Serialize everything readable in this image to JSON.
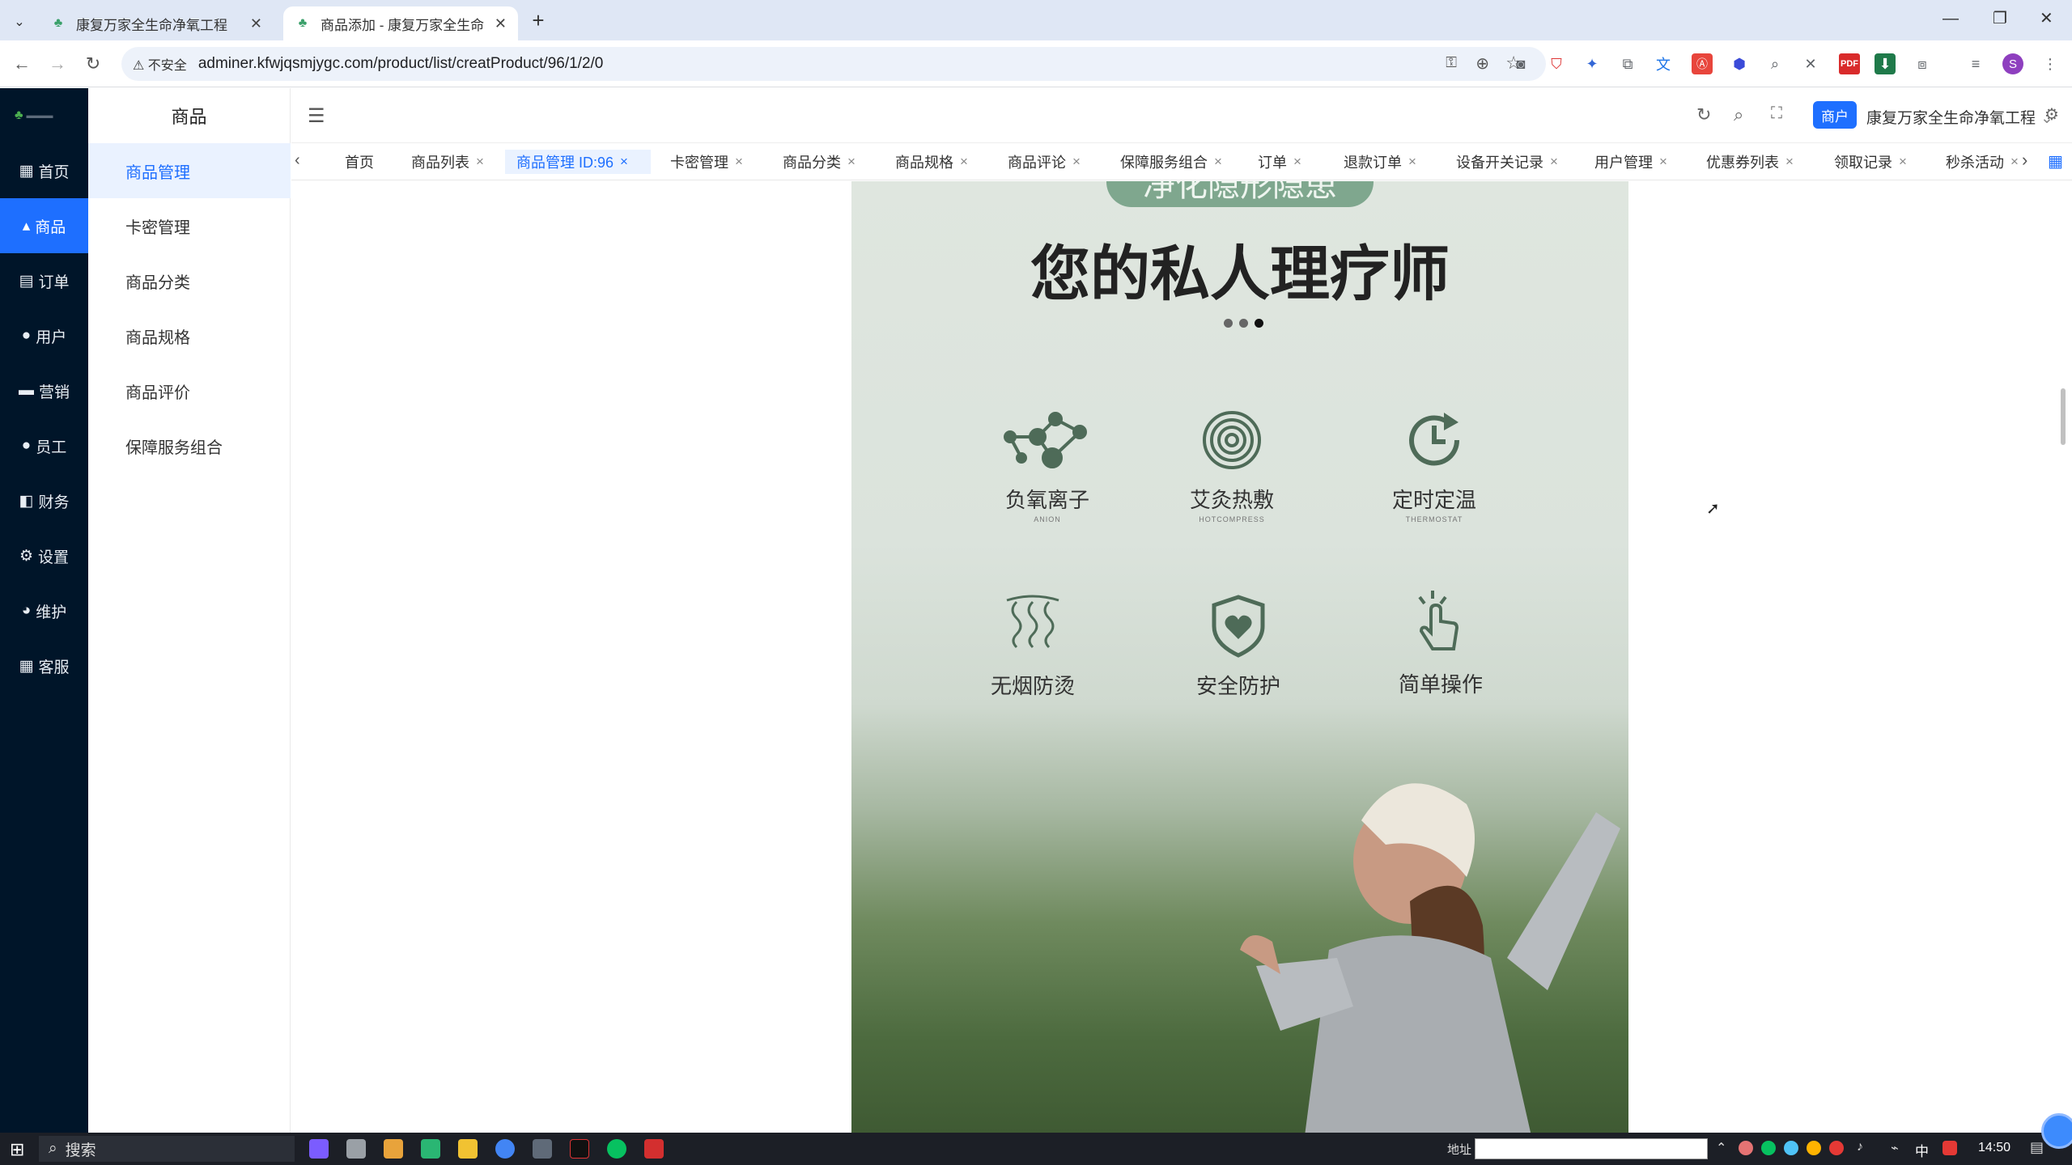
{
  "browser": {
    "tabs": [
      {
        "title": "康复万家全生命净氧工程",
        "active": false
      },
      {
        "title": "商品添加 - 康复万家全生命净氧",
        "active": true
      }
    ],
    "new_tab": "+",
    "security_label": "不安全",
    "url": "adminer.kfwjqsmjygc.com/product/list/creatProduct/96/1/2/0"
  },
  "app": {
    "brand_color": "#1e6fff",
    "rail": [
      {
        "icon": "dashboard-icon",
        "label": "首页",
        "active": false
      },
      {
        "icon": "goods-icon",
        "label": "商品",
        "active": true
      },
      {
        "icon": "order-icon",
        "label": "订单",
        "active": false
      },
      {
        "icon": "user-icon",
        "label": "用户",
        "active": false
      },
      {
        "icon": "marketing-icon",
        "label": "营销",
        "active": false
      },
      {
        "icon": "staff-icon",
        "label": "员工",
        "active": false
      },
      {
        "icon": "finance-icon",
        "label": "财务",
        "active": false
      },
      {
        "icon": "gear-icon",
        "label": "设置",
        "active": false
      },
      {
        "icon": "maintain-icon",
        "label": "维护",
        "active": false
      },
      {
        "icon": "service-icon",
        "label": "客服",
        "active": false
      }
    ],
    "submenu": {
      "title": "商品",
      "items": [
        {
          "label": "商品管理",
          "active": true
        },
        {
          "label": "卡密管理",
          "active": false
        },
        {
          "label": "商品分类",
          "active": false
        },
        {
          "label": "商品规格",
          "active": false
        },
        {
          "label": "商品评价",
          "active": false
        },
        {
          "label": "保障服务组合",
          "active": false
        }
      ]
    },
    "header": {
      "merchant_badge": "商户",
      "account_name": "康复万家全生命净氧工程"
    },
    "tags": [
      {
        "label": "首页",
        "closable": false,
        "active": false
      },
      {
        "label": "商品列表",
        "closable": true,
        "active": false
      },
      {
        "label": "商品管理 ID:96",
        "closable": true,
        "active": true
      },
      {
        "label": "卡密管理",
        "closable": true,
        "active": false
      },
      {
        "label": "商品分类",
        "closable": true,
        "active": false
      },
      {
        "label": "商品规格",
        "closable": true,
        "active": false
      },
      {
        "label": "商品评论",
        "closable": true,
        "active": false
      },
      {
        "label": "保障服务组合",
        "closable": true,
        "active": false
      },
      {
        "label": "订单",
        "closable": true,
        "active": false
      },
      {
        "label": "退款订单",
        "closable": true,
        "active": false
      },
      {
        "label": "设备开关记录",
        "closable": true,
        "active": false
      },
      {
        "label": "用户管理",
        "closable": true,
        "active": false
      },
      {
        "label": "优惠券列表",
        "closable": true,
        "active": false
      },
      {
        "label": "领取记录",
        "closable": true,
        "active": false
      },
      {
        "label": "秒杀活动",
        "closable": true,
        "active": false
      }
    ],
    "close_glyph": "×"
  },
  "poster": {
    "banner": "净化隐形隐患",
    "headline": "您的私人理疗师",
    "features": [
      {
        "cn": "负氧离子",
        "en": "ANION",
        "icon": "molecule-icon"
      },
      {
        "cn": "艾灸热敷",
        "en": "HOTCOMPRESS",
        "icon": "heat-rings-icon"
      },
      {
        "cn": "定时定温",
        "en": "THERMOSTAT",
        "icon": "timer-icon"
      },
      {
        "cn": "无烟防烫",
        "en": "",
        "icon": "smoke-waves-icon"
      },
      {
        "cn": "安全防护",
        "en": "",
        "icon": "shield-heart-icon"
      },
      {
        "cn": "简单操作",
        "en": "",
        "icon": "tap-hand-icon"
      }
    ]
  },
  "taskbar": {
    "search_label": "搜索",
    "address_label": "地址",
    "time": "14:50",
    "ime": "中"
  }
}
